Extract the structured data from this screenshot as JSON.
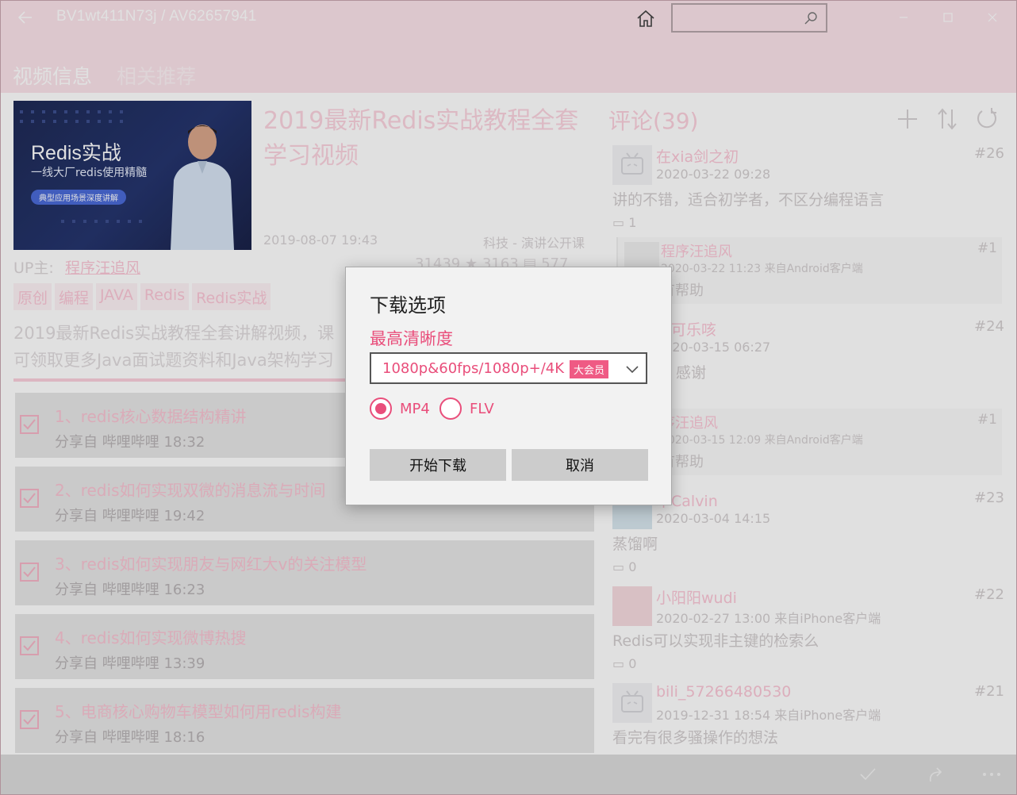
{
  "titlebar": {
    "title": "BV1wt411N73j / AV62657941",
    "search_placeholder": ""
  },
  "tabs": [
    {
      "label": "视频信息",
      "active": true
    },
    {
      "label": "相关推荐",
      "active": false
    }
  ],
  "video": {
    "cover": {
      "title": "Redis实战",
      "subtitle": "一线大厂redis使用精髓",
      "pill": "典型应用场景深度讲解"
    },
    "title": "2019最新Redis实战教程全套学习视频",
    "date": "2019-08-07 19:43",
    "category": "科技 - 演讲公开课",
    "up_label": "UP主:",
    "up_name": "程序汪追风",
    "stats": "31439 ★ 3163 ▤ 577",
    "tags": [
      "原创",
      "编程",
      "JAVA",
      "Redis",
      "Redis实战"
    ],
    "description_line1": "2019最新Redis实战教程全套讲解视频，课",
    "description_line2": "可领取更多Java面试题资料和Java架构学习"
  },
  "episodes": [
    {
      "title": "1、redis核心数据结构精讲",
      "sub": "分享自 哔哩哔哩 18:32"
    },
    {
      "title": "2、redis如何实现双微的消息流与时间",
      "sub": "分享自 哔哩哔哩 19:42"
    },
    {
      "title": "3、redis如何实现朋友与网红大v的关注模型",
      "sub": "分享自 哔哩哔哩 16:23"
    },
    {
      "title": "4、redis如何实现微博热搜",
      "sub": "分享自 哔哩哔哩 13:39"
    },
    {
      "title": "5、电商核心购物车模型如何用redis构建",
      "sub": "分享自 哔哩哔哩 18:16"
    }
  ],
  "comments_header": "评论(39)",
  "comments": [
    {
      "name": "在xia剑之初",
      "time": "2020-03-22 09:28",
      "num": "#26",
      "text": "讲的不错，适合初学者，不区分编程语言",
      "replies": "1"
    },
    {
      "name": "口可乐咳",
      "time": "2020-03-15 06:27",
      "num": "#24",
      "text": "感谢",
      "replies": ""
    },
    {
      "name": "甲Calvin",
      "time": "2020-03-04 14:15",
      "num": "#23",
      "text": "蒸馏啊",
      "replies": "0"
    },
    {
      "name": "小阳阳wudi",
      "time": "2020-02-27 13:00 来自iPhone客户端",
      "num": "#22",
      "text": "Redis可以实现非主键的检索么",
      "replies": "0"
    },
    {
      "name": "bili_57266480530",
      "time": "2019-12-31 18:54 来自iPhone客户端",
      "num": "#21",
      "text": "看完有很多骚操作的想法",
      "replies": ""
    }
  ],
  "replies": [
    {
      "name": "程序汪追风",
      "time": "2020-03-22 11:23 来自Android客户端",
      "num": "#1",
      "text": "有帮助"
    },
    {
      "name": "序汪追风",
      "time": "2020-03-15 12:09 来自Android客户端",
      "num": "#1",
      "text": "有帮助"
    }
  ],
  "dialog": {
    "title": "下载选项",
    "quality_label": "最高清晰度",
    "quality_value": "1080p&60fps/1080p+/4K",
    "quality_badge": "大会员",
    "format_options": [
      {
        "label": "MP4",
        "selected": true
      },
      {
        "label": "FLV",
        "selected": false
      }
    ],
    "start_label": "开始下载",
    "cancel_label": "取消"
  },
  "colors": {
    "accent": "#e94e7b",
    "titlebar": "#fbe3ea"
  }
}
